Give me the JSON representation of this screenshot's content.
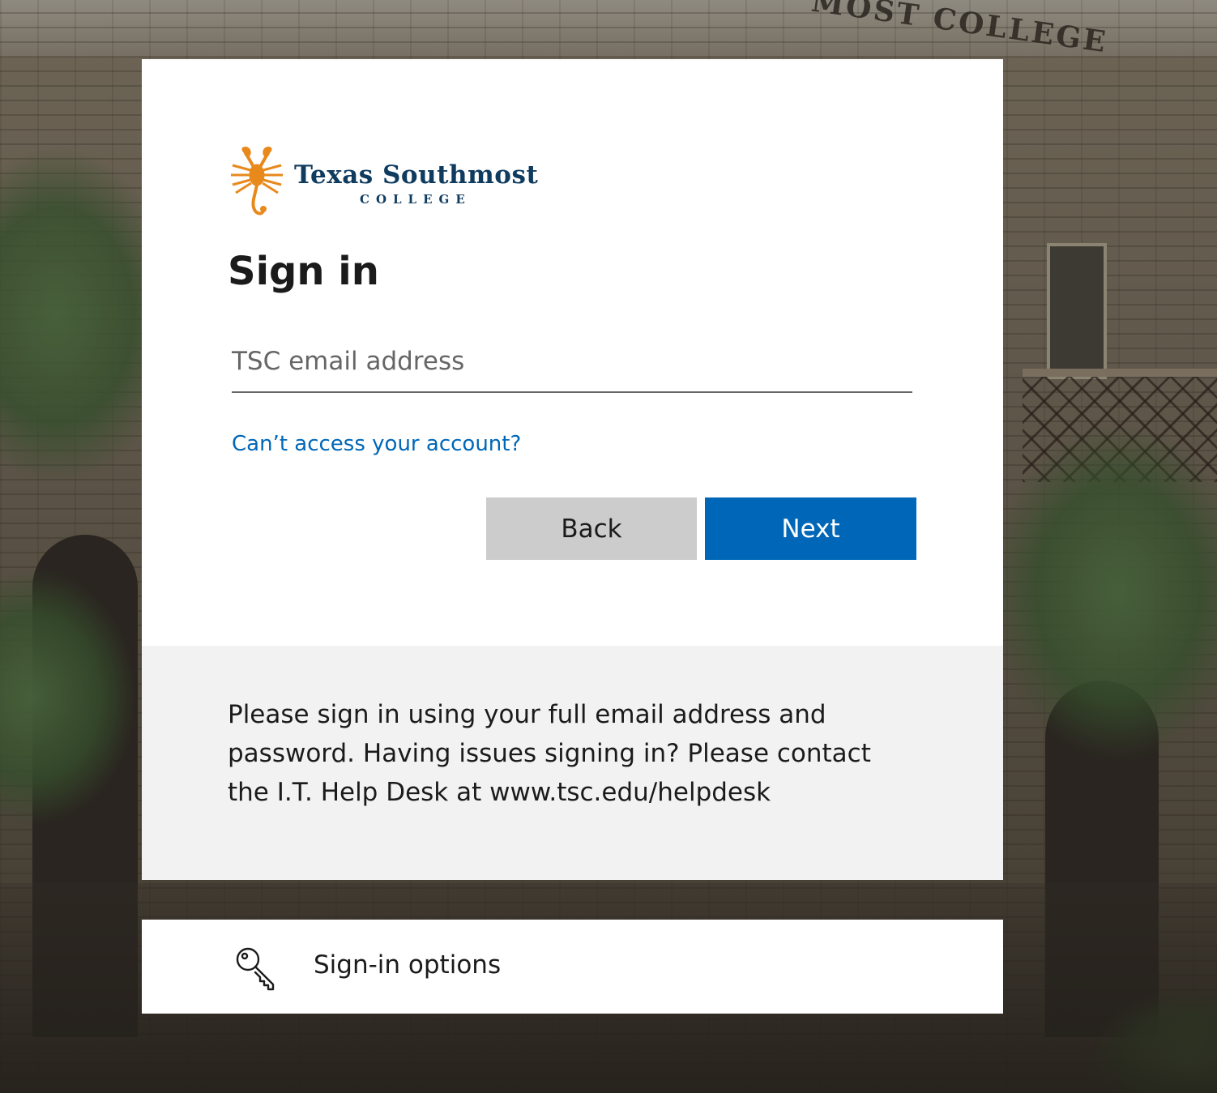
{
  "background": {
    "sign_text": "MOST COLLEGE"
  },
  "logo": {
    "title": "Texas Southmost",
    "subtitle": "COLLEGE",
    "accent_color": "#e8891c",
    "brand_color": "#0f3b5f"
  },
  "signin": {
    "title": "Sign in",
    "email_placeholder": "TSC email address",
    "email_value": "",
    "forgot_link": "Can’t access your account?",
    "back_label": "Back",
    "next_label": "Next"
  },
  "footer": {
    "message": "Please sign in using your full email address and password. Having issues signing in? Please contact the I.T. Help Desk at www.tsc.edu/helpdesk"
  },
  "options": {
    "label": "Sign-in options",
    "icon": "key-icon"
  },
  "colors": {
    "primary_button": "#0067b8",
    "secondary_button": "#cccccc",
    "link": "#0067b8",
    "footer_background": "#f2f2f2"
  }
}
